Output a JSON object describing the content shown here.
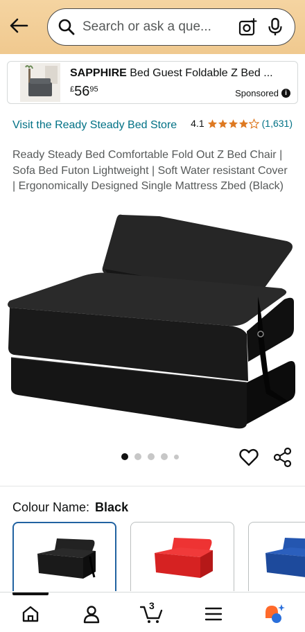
{
  "header": {
    "back_icon": "arrow-left-icon",
    "search_placeholder": "Search or ask a que...",
    "icons": [
      "search-icon",
      "camera-icon",
      "mic-icon"
    ]
  },
  "ad": {
    "brand": "SAPPHIRE",
    "title_rest": " Bed Guest Foldable Z Bed ...",
    "currency": "£",
    "price_whole": "56",
    "price_fraction": "95",
    "sponsored": "Sponsored",
    "info_icon": "i"
  },
  "product": {
    "store_link": "Visit the Ready Steady Bed Store",
    "rating_value": "4.1",
    "rating_stars": 4.1,
    "rating_count": "(1,631)",
    "title": "Ready Steady Bed Comfortable Fold Out Z Bed Chair | Sofa Bed Futon Lightweight | Soft Water resistant Cover | Ergonomically Designed Single Mattress Zbed (Black)",
    "image_count": 5,
    "active_image": 0
  },
  "colour": {
    "label": "Colour Name:",
    "selected": "Black",
    "options": [
      {
        "name": "Black",
        "color": "#1b1b1b"
      },
      {
        "name": "Red",
        "color": "#e02424"
      },
      {
        "name": "Blue",
        "color": "#1e4fa8"
      }
    ]
  },
  "bottom_nav": {
    "items": [
      "home-icon",
      "account-icon",
      "cart-icon",
      "menu-icon",
      "rufus-icon"
    ],
    "cart_count": "3"
  },
  "colors": {
    "link": "#007185",
    "star": "#de7921",
    "header_bg": "#f3cf98",
    "selected_border": "#2162a1"
  }
}
